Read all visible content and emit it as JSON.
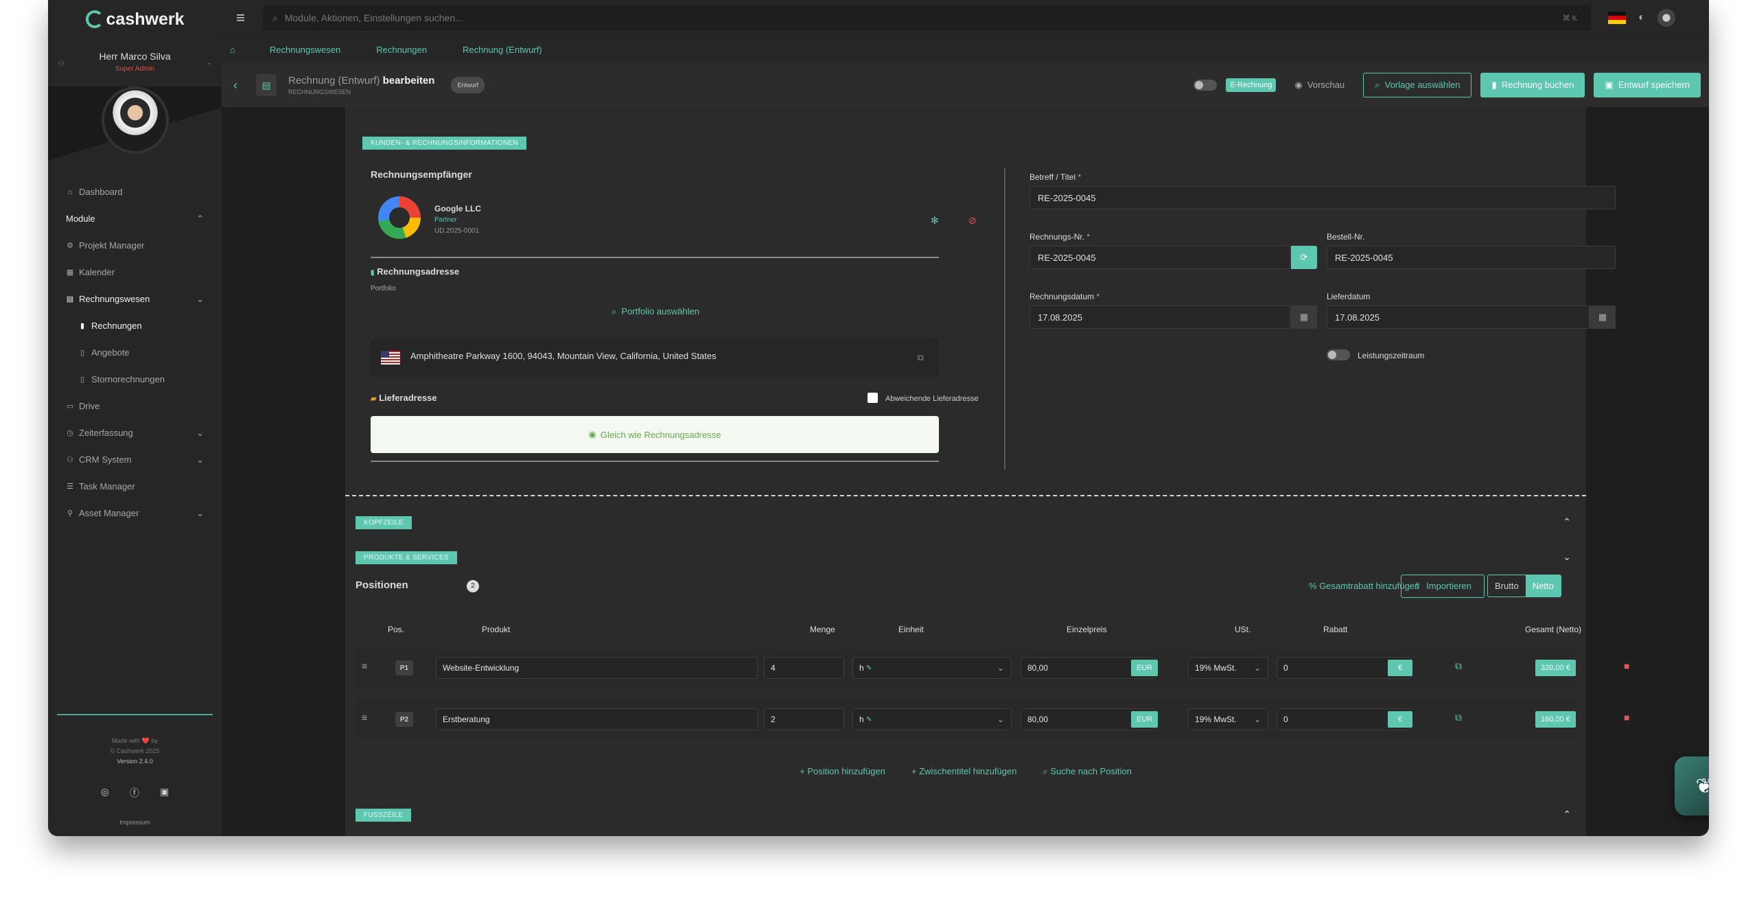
{
  "app": {
    "brand": "cashwerk"
  },
  "user": {
    "name": "Herr Marco Silva",
    "role": "Super Admin"
  },
  "sidebar": {
    "items": [
      {
        "label": "Dashboard",
        "icon": "home-icon"
      },
      {
        "label": "Module",
        "icon": ""
      },
      {
        "label": "Projekt Manager",
        "icon": "project-icon"
      },
      {
        "label": "Kalender",
        "icon": "calendar-icon"
      },
      {
        "label": "Rechnungswesen",
        "icon": "document-icon"
      },
      {
        "label": "Rechnungen",
        "icon": "file-icon"
      },
      {
        "label": "Angebote",
        "icon": "file-icon"
      },
      {
        "label": "Stornorechnungen",
        "icon": "file-icon"
      },
      {
        "label": "Drive",
        "icon": "drive-icon"
      },
      {
        "label": "Zeiterfassung",
        "icon": "clock-icon"
      },
      {
        "label": "CRM System",
        "icon": "users-icon"
      },
      {
        "label": "Task Manager",
        "icon": "tasks-icon"
      },
      {
        "label": "Asset Manager",
        "icon": "asset-icon"
      }
    ],
    "footer": {
      "made": "Made with ❤️ by",
      "copy": "© Cashwerk 2025",
      "version": "Version 2.4.0",
      "impressum": "Impressum"
    }
  },
  "topbar": {
    "search_placeholder": "Module, Aktionen, Einstellungen suchen...",
    "shortcut": "⌘ K"
  },
  "breadcrumb": [
    "Rechnungswesen",
    "Rechnungen",
    "Rechnung (Entwurf)"
  ],
  "toolbar": {
    "title_prefix": "Rechnung (Entwurf)",
    "title_action": "bearbeiten",
    "subtitle": "RECHNUNGSWESEN",
    "badge": "Entwurf",
    "erechnung": "E-Rechnung",
    "preview": "Vorschau",
    "template": "Vorlage auswählen",
    "book": "Rechnung buchen",
    "save": "Entwurf speichern"
  },
  "customer": {
    "section": "KUNDEN- & RECHNUNGSINFORMATIONEN",
    "recipient_heading": "Rechnungsempfänger",
    "company": "Google LLC",
    "type": "Partner",
    "id": "UD.2025-0001",
    "billing_heading": "Rechnungsadresse",
    "portfolio_label": "Portfolio",
    "portfolio_btn": "Portfolio auswählen",
    "address": "Amphitheatre Parkway 1600, 94043, Mountain View, California, United States",
    "delivery_heading": "Lieferadresse",
    "delivery_checkbox": "Abweichende Lieferadresse",
    "same_btn": "Gleich wie Rechnungsadresse"
  },
  "invoice": {
    "subject_label": "Betreff / Titel",
    "subject": "RE-2025-0045",
    "number_label": "Rechnungs-Nr.",
    "number": "RE-2025-0045",
    "order_label": "Bestell-Nr.",
    "order": "RE-2025-0045",
    "date_label": "Rechnungsdatum",
    "date": "17.08.2025",
    "delivery_label": "Lieferdatum",
    "delivery": "17.08.2025",
    "period_label": "Leistungszeitraum",
    "req": "*"
  },
  "sections": {
    "header": "KOPFZEILE",
    "products": "PRODUKTE & SERVICES",
    "footer": "FUSSZEILE"
  },
  "positions": {
    "title": "Positionen",
    "count": "2",
    "discount_link": "Gesamtrabatt hinzufügen",
    "import": "Importieren",
    "brutto": "Brutto",
    "netto": "Netto",
    "columns": [
      "Pos.",
      "Produkt",
      "Menge",
      "Einheit",
      "Einzelpreis",
      "USt.",
      "Rabatt",
      "Gesamt (Netto)"
    ],
    "rows": [
      {
        "pos": "P1",
        "product": "Website-Entwicklung",
        "qty": "4",
        "unit": "h",
        "price": "80,00",
        "currency": "EUR",
        "vat": "19% MwSt.",
        "discount": "0",
        "disc_unit": "€",
        "total": "320,00 €"
      },
      {
        "pos": "P2",
        "product": "Erstberatung",
        "qty": "2",
        "unit": "h",
        "price": "80,00",
        "currency": "EUR",
        "vat": "19% MwSt.",
        "discount": "0",
        "disc_unit": "€",
        "total": "160,00 €"
      }
    ],
    "add_position": "Position hinzufügen",
    "add_subtitle": "Zwischentitel hinzufügen",
    "search_position": "Suche nach Position"
  }
}
